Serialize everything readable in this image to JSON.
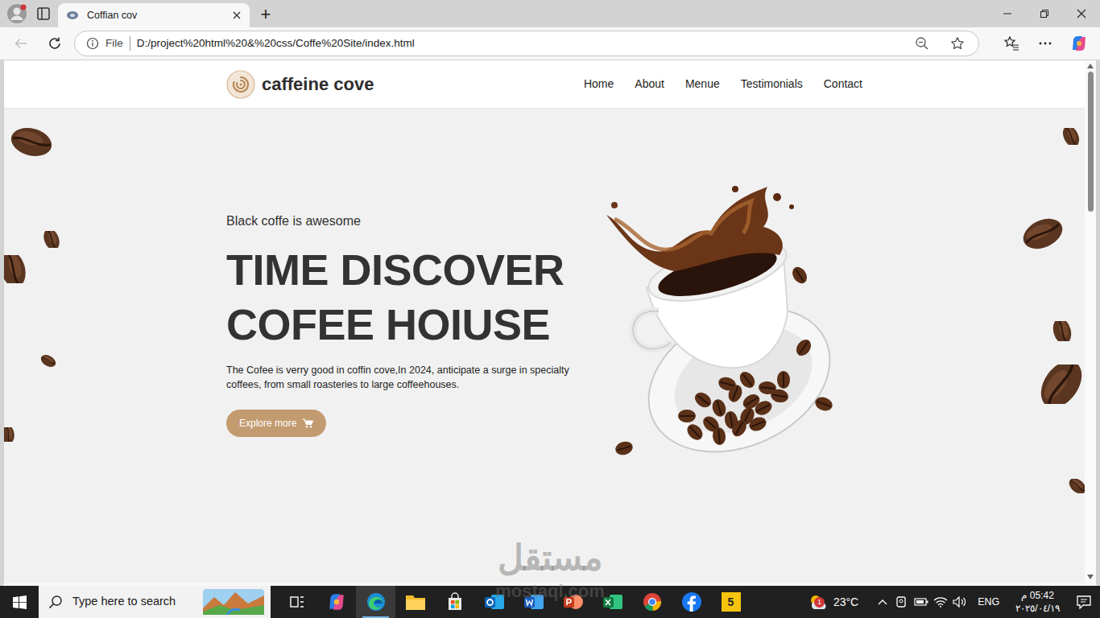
{
  "browser": {
    "tab": {
      "title": "Coffian cov",
      "selected": true
    },
    "new_tab": "+",
    "back_disabled": true,
    "address": {
      "scheme": "File",
      "url": "D:/project%20html%20&%20css/Coffe%20Site/index.html"
    },
    "scrollbar": {
      "level": 0.28
    }
  },
  "page": {
    "brand": "caffeine cove",
    "nav": [
      "Home",
      "About",
      "Menue",
      "Testimonials",
      "Contact"
    ],
    "hero": {
      "eyebrow": "Black coffe is awesome",
      "title_lines": [
        "TIME DISCOVER",
        "COFEE HOIUSE"
      ],
      "text": "The Cofee is verry good in coffin cove,In 2024, anticipate a surge in specialty coffees, from small roasteries to large coffeehouses.",
      "button": "Explore more"
    }
  },
  "watermark": {
    "arabic": "مستقل",
    "latin": "mostaql.com"
  },
  "taskbar": {
    "search_placeholder": "Type here to search",
    "apps": [
      {
        "kind": "taskview",
        "selected": false
      },
      {
        "kind": "copilot",
        "selected": false
      },
      {
        "kind": "edge",
        "selected": true
      },
      {
        "kind": "explorer",
        "selected": false
      },
      {
        "kind": "store",
        "selected": false
      },
      {
        "kind": "outlook",
        "selected": false
      },
      {
        "kind": "word",
        "selected": false
      },
      {
        "kind": "powerpoint",
        "selected": false
      },
      {
        "kind": "excel",
        "selected": false
      },
      {
        "kind": "chrome",
        "selected": false
      },
      {
        "kind": "facebook",
        "selected": false
      },
      {
        "kind": "five",
        "selected": false,
        "label": "5"
      }
    ],
    "weather": {
      "temp": "23°C",
      "badge": "1"
    },
    "language": "ENG",
    "time": "05:42 م",
    "date": "٢٠٢٥/٠٤/١٩"
  }
}
